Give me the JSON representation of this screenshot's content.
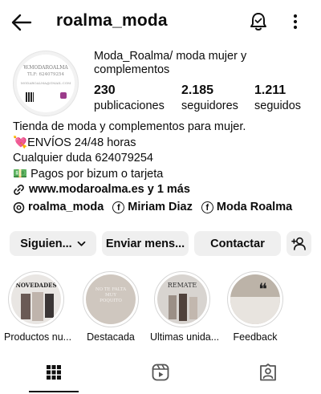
{
  "header": {
    "username": "roalma_moda",
    "back_icon": "back-arrow-icon",
    "bell_icon": "notification-bell-icon",
    "more_icon": "more-vertical-icon"
  },
  "profile": {
    "avatar_text": {
      "line1": "W.MODAROALMA",
      "line2": "TLF: 624079254",
      "line3": "MODAROALMA@GMAIL.COM"
    },
    "display_name": "Moda_Roalma/ moda mujer y complementos",
    "stats": [
      {
        "value": "230",
        "label": "publicaciones"
      },
      {
        "value": "2.185",
        "label": "seguidores"
      },
      {
        "value": "1.211",
        "label": "seguidos"
      }
    ]
  },
  "bio": {
    "line1": "Tienda de moda y complementos para mujer.",
    "line2": "ENVÍOS 24/48 horas",
    "line2_emoji": "💘",
    "line3": "Cualquier duda 624079254",
    "line4": "Pagos por bizum o tarjeta",
    "line4_emoji": "💵",
    "link": "www.modaroalma.es y 1 más"
  },
  "socials": [
    {
      "label": "roalma_moda",
      "icon": "threads-icon"
    },
    {
      "label": "Miriam Diaz",
      "icon": "facebook-icon"
    },
    {
      "label": "Moda Roalma",
      "icon": "facebook-icon"
    }
  ],
  "actions": {
    "following": "Siguien...",
    "message": "Enviar mens...",
    "contact": "Contactar",
    "add_person_icon": "add-person-icon"
  },
  "highlights": [
    {
      "label": "Productos nu...",
      "cover_text": "NOVEDADES"
    },
    {
      "label": "Destacada",
      "cover_text": "NO TE FALTA MUY POQUITO"
    },
    {
      "label": "Ultimas unida...",
      "cover_text": "REMATE"
    },
    {
      "label": "Feedback",
      "cover_text": "❝"
    }
  ],
  "tabs": [
    {
      "name": "grid",
      "icon": "grid-icon"
    },
    {
      "name": "reels",
      "icon": "reels-icon"
    },
    {
      "name": "tagged",
      "icon": "tagged-icon"
    }
  ],
  "colors": {
    "button_bg": "#efefef",
    "text": "#0c0c0c",
    "heart": "#e0457b"
  }
}
